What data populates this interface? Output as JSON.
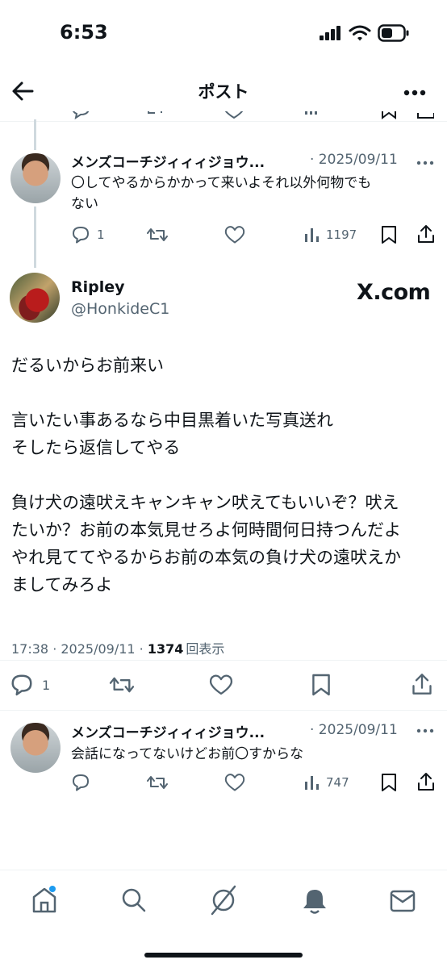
{
  "status_bar": {
    "time": "6:53"
  },
  "header": {
    "title": "ポスト"
  },
  "reply1": {
    "name": "メンズコーチジィィィジョウ...",
    "date": "· 2025/09/11",
    "text_line1": "〇してやるからかかって来いよそれ以外何物でも",
    "text_line2": "ない",
    "replies": "1",
    "views": "1197"
  },
  "main_post": {
    "name": "Ripley",
    "handle": "@HonkideC1",
    "watermark": "X.com",
    "lines": [
      "だるいからお前来い",
      "",
      "言いたい事あるなら中目黒着いた写真送れ",
      "そしたら返信してやる",
      "",
      "負け犬の遠吠えキャンキャン吠えてもいいぞ？吠え",
      "たいか？お前の本気見せろよ何時間何日持つんだよ",
      "やれ見ててやるからお前の本気の負け犬の遠吠えか",
      "ましてみろよ"
    ],
    "timestamp": "17:38 · 2025/09/11 · ",
    "views": "1374",
    "views_label": "回表示",
    "replies": "1"
  },
  "reply2": {
    "name": "メンズコーチジィィィジョウ...",
    "date": "· 2025/09/11",
    "text": "会話になってないけどお前〇すからな",
    "views": "747"
  },
  "colors": {
    "accent": "#1d9bf0",
    "secondary": "#536471"
  }
}
